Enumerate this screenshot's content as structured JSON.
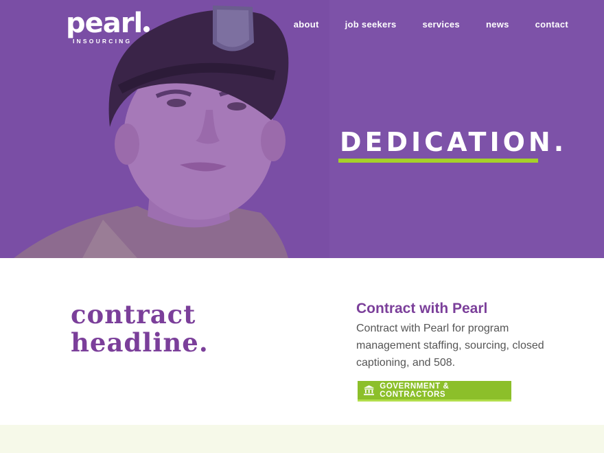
{
  "logo": {
    "word": "pearl",
    "sub": "INSOURCING"
  },
  "nav": [
    {
      "label": "about"
    },
    {
      "label": "job seekers"
    },
    {
      "label": "services"
    },
    {
      "label": "news"
    },
    {
      "label": "contact"
    }
  ],
  "hero": {
    "title": "DEDICATION.",
    "accent_color": "#a5d12a",
    "background_color": "#7b4fa6"
  },
  "content": {
    "headline_line1": "contract",
    "headline_line2": "headline.",
    "sub_title": "Contract with Pearl",
    "sub_body": "Contract with Pearl for program management staffing, sourcing, closed captioning, and  508.",
    "cta": {
      "label": "GOVERNMENT & CONTRACTORS",
      "icon": "bank-icon"
    }
  },
  "colors": {
    "brand_purple": "#7b3f9a",
    "button_green": "#8cbf2a",
    "footer_band": "#f6f9e9"
  }
}
